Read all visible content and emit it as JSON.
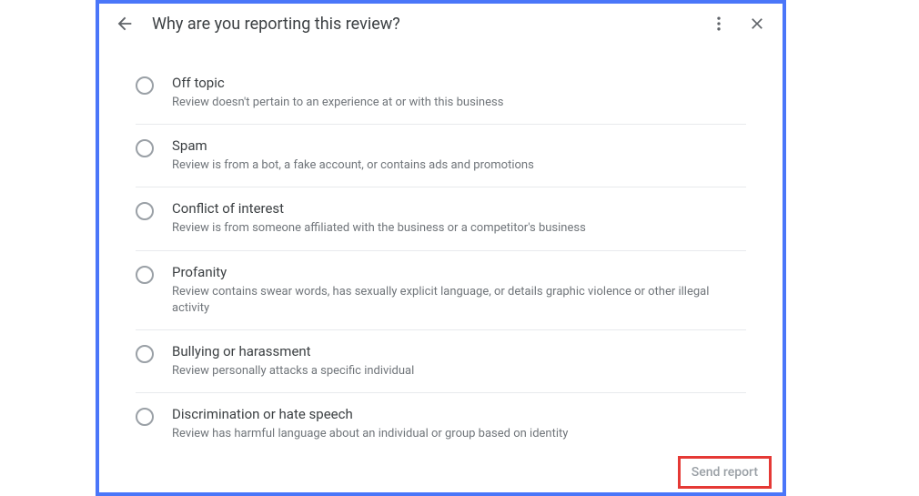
{
  "header": {
    "title": "Why are you reporting this review?"
  },
  "options": [
    {
      "title": "Off topic",
      "desc": "Review doesn't pertain to an experience at or with this business"
    },
    {
      "title": "Spam",
      "desc": "Review is from a bot, a fake account, or contains ads and promotions"
    },
    {
      "title": "Conflict of interest",
      "desc": "Review is from someone affiliated with the business or a competitor's business"
    },
    {
      "title": "Profanity",
      "desc": "Review contains swear words, has sexually explicit language, or details graphic violence or other illegal activity"
    },
    {
      "title": "Bullying or harassment",
      "desc": "Review personally attacks a specific individual"
    },
    {
      "title": "Discrimination or hate speech",
      "desc": "Review has harmful language about an individual or group based on identity"
    }
  ],
  "footer": {
    "send_label": "Send report"
  }
}
